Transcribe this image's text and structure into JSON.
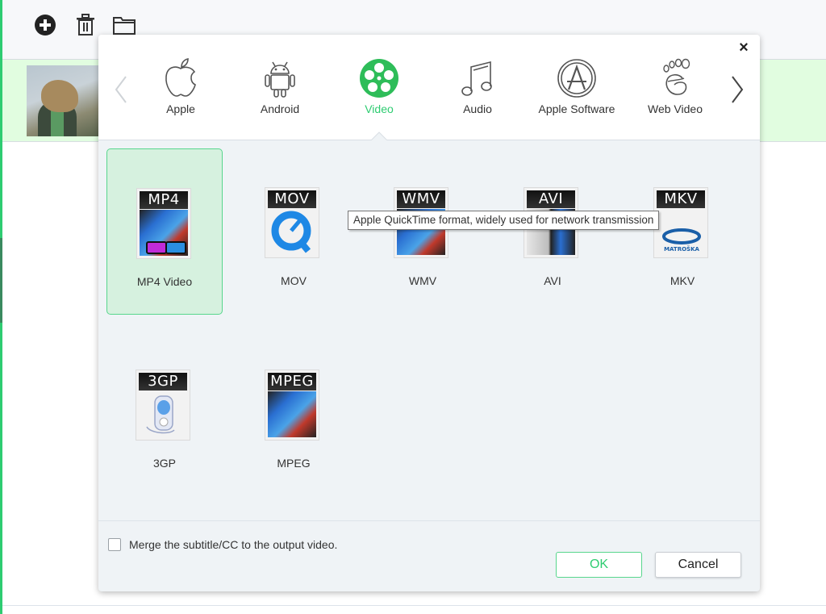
{
  "background": {
    "toolbar": {
      "icons": [
        "add-icon",
        "trash-icon",
        "folder-icon"
      ]
    },
    "file_item": {
      "thumbnail": "video-thumbnail"
    }
  },
  "dialog": {
    "close_label": "×",
    "categories": [
      {
        "label": "Apple",
        "icon": "apple-icon",
        "active": false
      },
      {
        "label": "Android",
        "icon": "android-icon",
        "active": false
      },
      {
        "label": "Video",
        "icon": "film-reel-icon",
        "active": true
      },
      {
        "label": "Audio",
        "icon": "music-note-icon",
        "active": false
      },
      {
        "label": "Apple Software",
        "icon": "app-store-icon",
        "active": false
      },
      {
        "label": "Web Video",
        "icon": "web-video-icon",
        "active": false
      }
    ],
    "formats": [
      {
        "tag": "MP4",
        "label": "MP4 Video",
        "selected": true
      },
      {
        "tag": "MOV",
        "label": "MOV",
        "selected": false
      },
      {
        "tag": "WMV",
        "label": "WMV",
        "selected": false
      },
      {
        "tag": "AVI",
        "label": "AVI",
        "selected": false
      },
      {
        "tag": "MKV",
        "label": "MKV",
        "selected": false
      },
      {
        "tag": "3GP",
        "label": "3GP",
        "selected": false
      },
      {
        "tag": "MPEG",
        "label": "MPEG",
        "selected": false
      }
    ],
    "tooltip": "Apple QuickTime format, widely used for network transmission",
    "merge_label": "Merge the subtitle/CC to the output video.",
    "merge_checked": false,
    "ok_label": "OK",
    "cancel_label": "Cancel"
  },
  "colors": {
    "accent": "#2ecc71",
    "selected_bg": "#d6f1df",
    "row_highlight": "#e1fde0"
  }
}
